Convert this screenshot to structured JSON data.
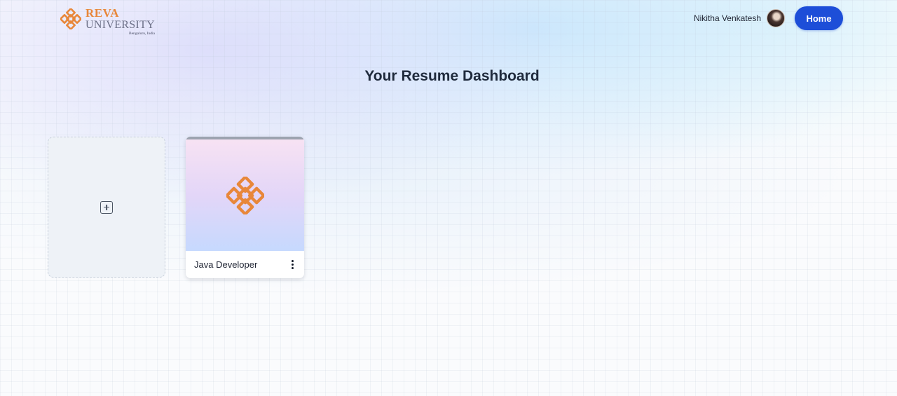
{
  "header": {
    "logo": {
      "name": "REVA",
      "subtitle": "UNIVERSITY",
      "location": "Bengaluru, India",
      "icon": "reva-knot-logo-icon",
      "color": "#e8873a"
    },
    "user": {
      "name": "Nikitha Venkatesh",
      "avatar_icon": "user-avatar"
    },
    "home_button": {
      "label": "Home",
      "color": "#1d4ed8"
    }
  },
  "main": {
    "title": "Your Resume Dashboard",
    "add_card": {
      "icon": "plus-square-icon"
    },
    "resumes": [
      {
        "title": "Java Developer",
        "thumbnail_icon": "reva-knot-logo-icon",
        "menu_icon": "more-vertical-icon"
      }
    ]
  }
}
